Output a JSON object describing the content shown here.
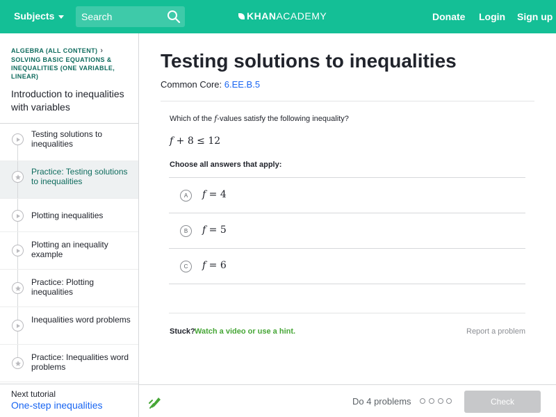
{
  "header": {
    "subjects_label": "Subjects",
    "search_placeholder": "Search",
    "logo_bold": "KHAN",
    "logo_light": "ACADEMY",
    "donate_label": "Donate",
    "login_label": "Login",
    "signup_label": "Sign up",
    "brand_color": "#14bf96"
  },
  "sidebar": {
    "breadcrumb_1": "ALGEBRA (ALL CONTENT)",
    "breadcrumb_2": "SOLVING BASIC EQUATIONS & INEQUALITIES (ONE VARIABLE, LINEAR)",
    "title": "Introduction to inequalities with variables",
    "items": [
      {
        "label": "Testing solutions to inequalities",
        "icon": "play-icon",
        "active": false
      },
      {
        "label": "Practice: Testing solutions to inequalities",
        "icon": "star-icon",
        "active": true
      },
      {
        "label": "Plotting inequalities",
        "icon": "play-icon",
        "active": false
      },
      {
        "label": "Plotting an inequality example",
        "icon": "play-icon",
        "active": false
      },
      {
        "label": "Practice: Plotting inequalities",
        "icon": "star-icon",
        "active": false
      },
      {
        "label": "Inequalities word problems",
        "icon": "play-icon",
        "active": false
      },
      {
        "label": "Practice: Inequalities word problems",
        "icon": "star-icon",
        "active": false
      }
    ],
    "next_label": "Next tutorial",
    "next_link": "One-step inequalities"
  },
  "main": {
    "title": "Testing solutions to inequalities",
    "common_core_label": "Common Core:",
    "common_core_code": "6.EE.B.5",
    "question_pre": "Which of the",
    "question_var": "f",
    "question_post": "-values satisfy the following inequality?",
    "expression_var": "f",
    "expression_rest": " + 8 ≤ 12",
    "choose_label": "Choose all answers that apply:",
    "choices": [
      {
        "letter": "A",
        "var": "f",
        "rest": " = 4"
      },
      {
        "letter": "B",
        "var": "f",
        "rest": " = 5"
      },
      {
        "letter": "C",
        "var": "f",
        "rest": " = 6"
      }
    ],
    "stuck_label": "Stuck?",
    "hint_label": "Watch a video or use a hint.",
    "report_label": "Report a problem"
  },
  "footer": {
    "do_problems_label": "Do 4 problems",
    "progress_dots": 4,
    "check_label": "Check"
  }
}
